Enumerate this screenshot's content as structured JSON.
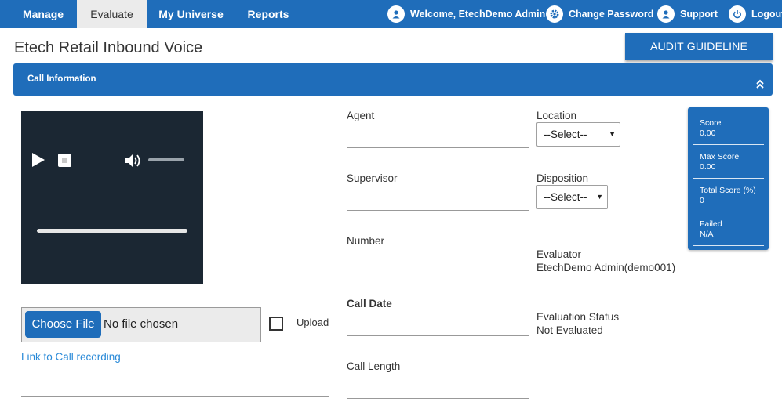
{
  "nav": {
    "tabs": [
      {
        "label": "Manage"
      },
      {
        "label": "Evaluate"
      },
      {
        "label": "My Universe"
      },
      {
        "label": "Reports"
      }
    ],
    "user": {
      "welcome": "Welcome, EtechDemo Admin",
      "change_password": "Change Password",
      "support": "Support",
      "logout": "Logout"
    }
  },
  "page": {
    "title": "Etech Retail Inbound Voice",
    "audit_button": "AUDIT GUIDELINE",
    "section_label": "Call Information"
  },
  "recording": {
    "choose_file": "Choose File",
    "no_file": "No file chosen",
    "upload_label": "Upload",
    "link_label": "Link to Call recording"
  },
  "fields": {
    "agent": "Agent",
    "supervisor": "Supervisor",
    "number": "Number",
    "call_date": "Call Date",
    "call_length": "Call Length",
    "location": "Location",
    "location_value": "--Select--",
    "disposition": "Disposition",
    "disposition_value": "--Select--",
    "evaluator_label": "Evaluator",
    "evaluator_value": "EtechDemo Admin(demo001)",
    "status_label": "Evaluation Status",
    "status_value": "Not Evaluated"
  },
  "score": {
    "score_label": "Score",
    "score_value": "0.00",
    "max_label": "Max Score",
    "max_value": "0.00",
    "total_label": "Total Score (%)",
    "total_value": "0",
    "failed_label": "Failed",
    "failed_value": "N/A"
  },
  "colors": {
    "primary": "#1f6dba",
    "player_bg": "#1b2733",
    "link": "#2a8ad8"
  },
  "icons": {
    "welcome": "user-icon",
    "change_password": "gear-icon",
    "support": "user-icon",
    "logout": "power-icon",
    "collapse": "double-chevron-up-icon"
  }
}
